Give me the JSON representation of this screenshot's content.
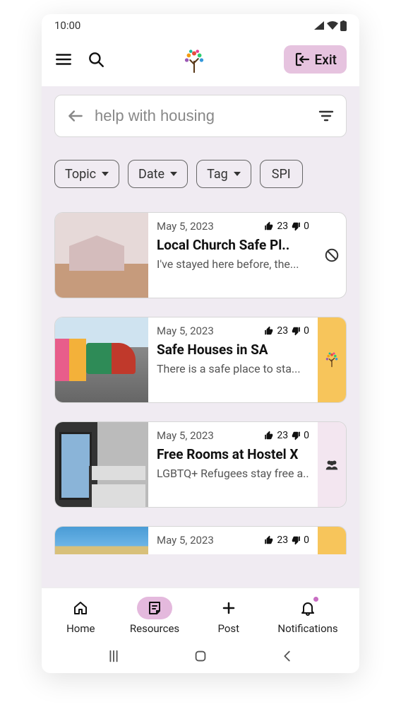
{
  "status": {
    "time": "10:00"
  },
  "header": {
    "exit_label": "Exit"
  },
  "search": {
    "query": "help with housing"
  },
  "filters": [
    {
      "label": "Topic",
      "has_dropdown": true
    },
    {
      "label": "Date",
      "has_dropdown": true
    },
    {
      "label": "Tag",
      "has_dropdown": true
    },
    {
      "label": "SPI",
      "has_dropdown": false
    }
  ],
  "cards": [
    {
      "date": "May 5, 2023",
      "up": 23,
      "down": 0,
      "title": "Local Church Safe Pl..",
      "desc": "I've stayed here before, the...",
      "side_icon": "block"
    },
    {
      "date": "May 5, 2023",
      "up": 23,
      "down": 0,
      "title": "Safe Houses in SA",
      "desc": "There is a safe place to sta...",
      "side_accent": "yellow",
      "side_icon": "tree"
    },
    {
      "date": "May 5, 2023",
      "up": 23,
      "down": 0,
      "title": "Free Rooms at Hostel X",
      "desc": "LGBTQ+ Refugees stay free a..",
      "side_accent": "pink",
      "side_icon": "people"
    },
    {
      "date": "May 5, 2023",
      "up": 23,
      "down": 0,
      "title": "",
      "desc": "",
      "side_accent": "yellow"
    }
  ],
  "nav": {
    "items": [
      {
        "label": "Home",
        "icon": "home"
      },
      {
        "label": "Resources",
        "icon": "note",
        "active": true
      },
      {
        "label": "Post",
        "icon": "plus"
      },
      {
        "label": "Notifications",
        "icon": "bell"
      }
    ]
  }
}
